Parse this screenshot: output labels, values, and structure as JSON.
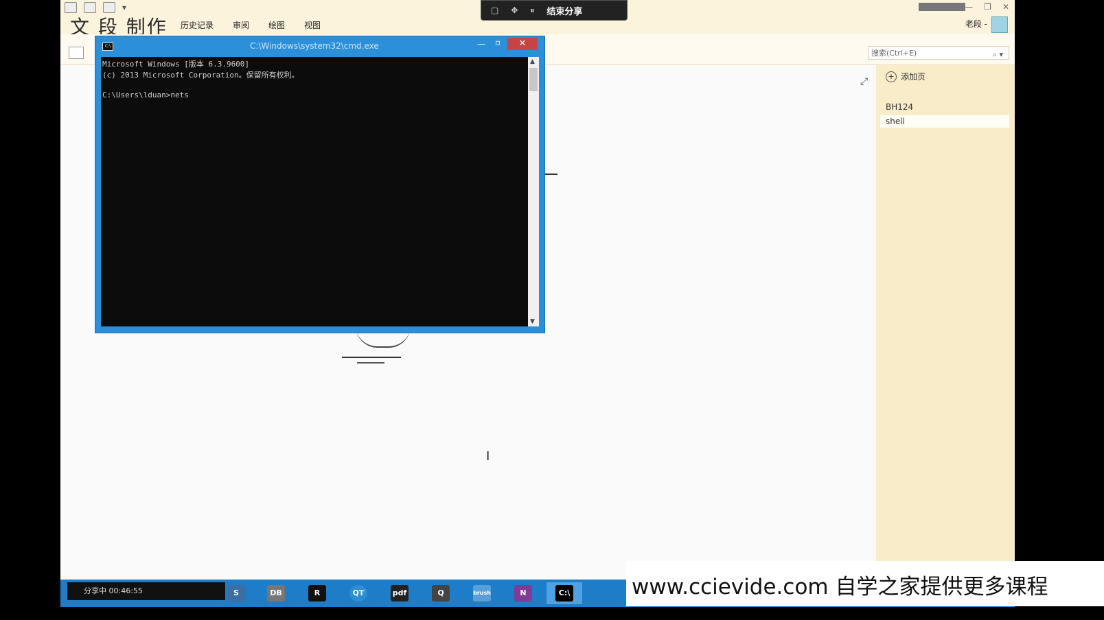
{
  "app": {
    "watermark": "文 段 制作",
    "menu": [
      "历史记录",
      "审阅",
      "绘图",
      "视图"
    ],
    "user": "老段 -",
    "search_placeholder": "搜索(Ctrl+E)",
    "pages": {
      "add_label": "添加页",
      "items": [
        "BH124",
        "shell"
      ]
    }
  },
  "share_bar": {
    "end_label": "结束分享"
  },
  "cmd": {
    "title": "C:\\Windows\\system32\\cmd.exe",
    "lines": [
      "Microsoft Windows [版本 6.3.9600]",
      "(c) 2013 Microsoft Corporation。保留所有权利。",
      "",
      "C:\\Users\\lduan>nets"
    ]
  },
  "taskbar": {
    "share_status": "分享中 00:46:55",
    "apps": [
      "S",
      "DB",
      "R",
      "QT",
      "pdf",
      "Q",
      "brush",
      "N",
      "C:\\"
    ]
  },
  "banner": {
    "text": "www.ccievide.com 自学之家提供更多课程"
  },
  "colors": {
    "ribbon": "#fbf3dc",
    "pages_panel": "#f9ecc9",
    "cmd_frame": "#2b90d9",
    "taskbar": "#1d7dc9"
  }
}
